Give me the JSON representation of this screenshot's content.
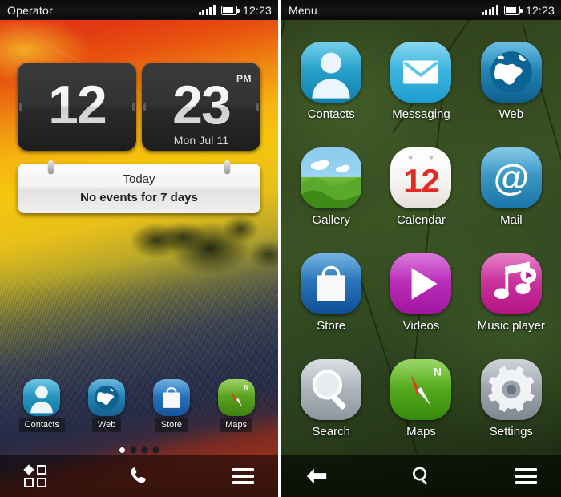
{
  "left": {
    "statusbar": {
      "title": "Operator",
      "time": "12:23",
      "signal_icon": "signal-bars-icon",
      "battery_icon": "battery-icon"
    },
    "clock": {
      "hours": "12",
      "minutes": "23",
      "ampm": "PM",
      "date": "Mon Jul 11"
    },
    "calendar_widget": {
      "title": "Today",
      "events": "No events for 7 days"
    },
    "dock": [
      {
        "label": "Contacts",
        "icon": "contacts-icon"
      },
      {
        "label": "Web",
        "icon": "web-icon"
      },
      {
        "label": "Store",
        "icon": "store-icon"
      },
      {
        "label": "Maps",
        "icon": "maps-icon"
      }
    ],
    "pager": {
      "total": 4,
      "active": 1
    },
    "toolbar": [
      {
        "name": "apps-grid-button",
        "icon": "apps-grid-icon"
      },
      {
        "name": "dialer-button",
        "icon": "phone-handset-icon"
      },
      {
        "name": "options-menu-button",
        "icon": "hamburger-menu-icon"
      }
    ]
  },
  "right": {
    "statusbar": {
      "title": "Menu",
      "time": "12:23",
      "signal_icon": "signal-bars-icon",
      "battery_icon": "battery-icon"
    },
    "apps": [
      {
        "label": "Contacts",
        "icon": "contacts-icon",
        "color": "#1d9dc8"
      },
      {
        "label": "Messaging",
        "icon": "messaging-icon",
        "color": "#3fb6e0"
      },
      {
        "label": "Web",
        "icon": "web-icon",
        "color": "#1b7fb8"
      },
      {
        "label": "Gallery",
        "icon": "gallery-icon",
        "color": "#62a83c"
      },
      {
        "label": "Calendar",
        "icon": "calendar-icon",
        "color": "#f4f2ef"
      },
      {
        "label": "Mail",
        "icon": "mail-at-icon",
        "color": "#2f95c8"
      },
      {
        "label": "Store",
        "icon": "store-icon",
        "color": "#1f6fb5"
      },
      {
        "label": "Videos",
        "icon": "videos-play-icon",
        "color": "#bb2dbb"
      },
      {
        "label": "Music player",
        "icon": "music-note-icon",
        "color": "#cc2f9e"
      },
      {
        "label": "Search",
        "icon": "search-icon",
        "color": "#aab0b8"
      },
      {
        "label": "Maps",
        "icon": "maps-compass-icon",
        "color": "#4fa417"
      },
      {
        "label": "Settings",
        "icon": "settings-gear-icon",
        "color": "#9aa3ab"
      }
    ],
    "calendar_icon_day": "12",
    "compass_north": "N",
    "toolbar": [
      {
        "name": "back-button",
        "icon": "back-arrow-icon"
      },
      {
        "name": "search-button",
        "icon": "search-icon"
      },
      {
        "name": "options-menu-button",
        "icon": "hamburger-menu-icon"
      }
    ]
  }
}
